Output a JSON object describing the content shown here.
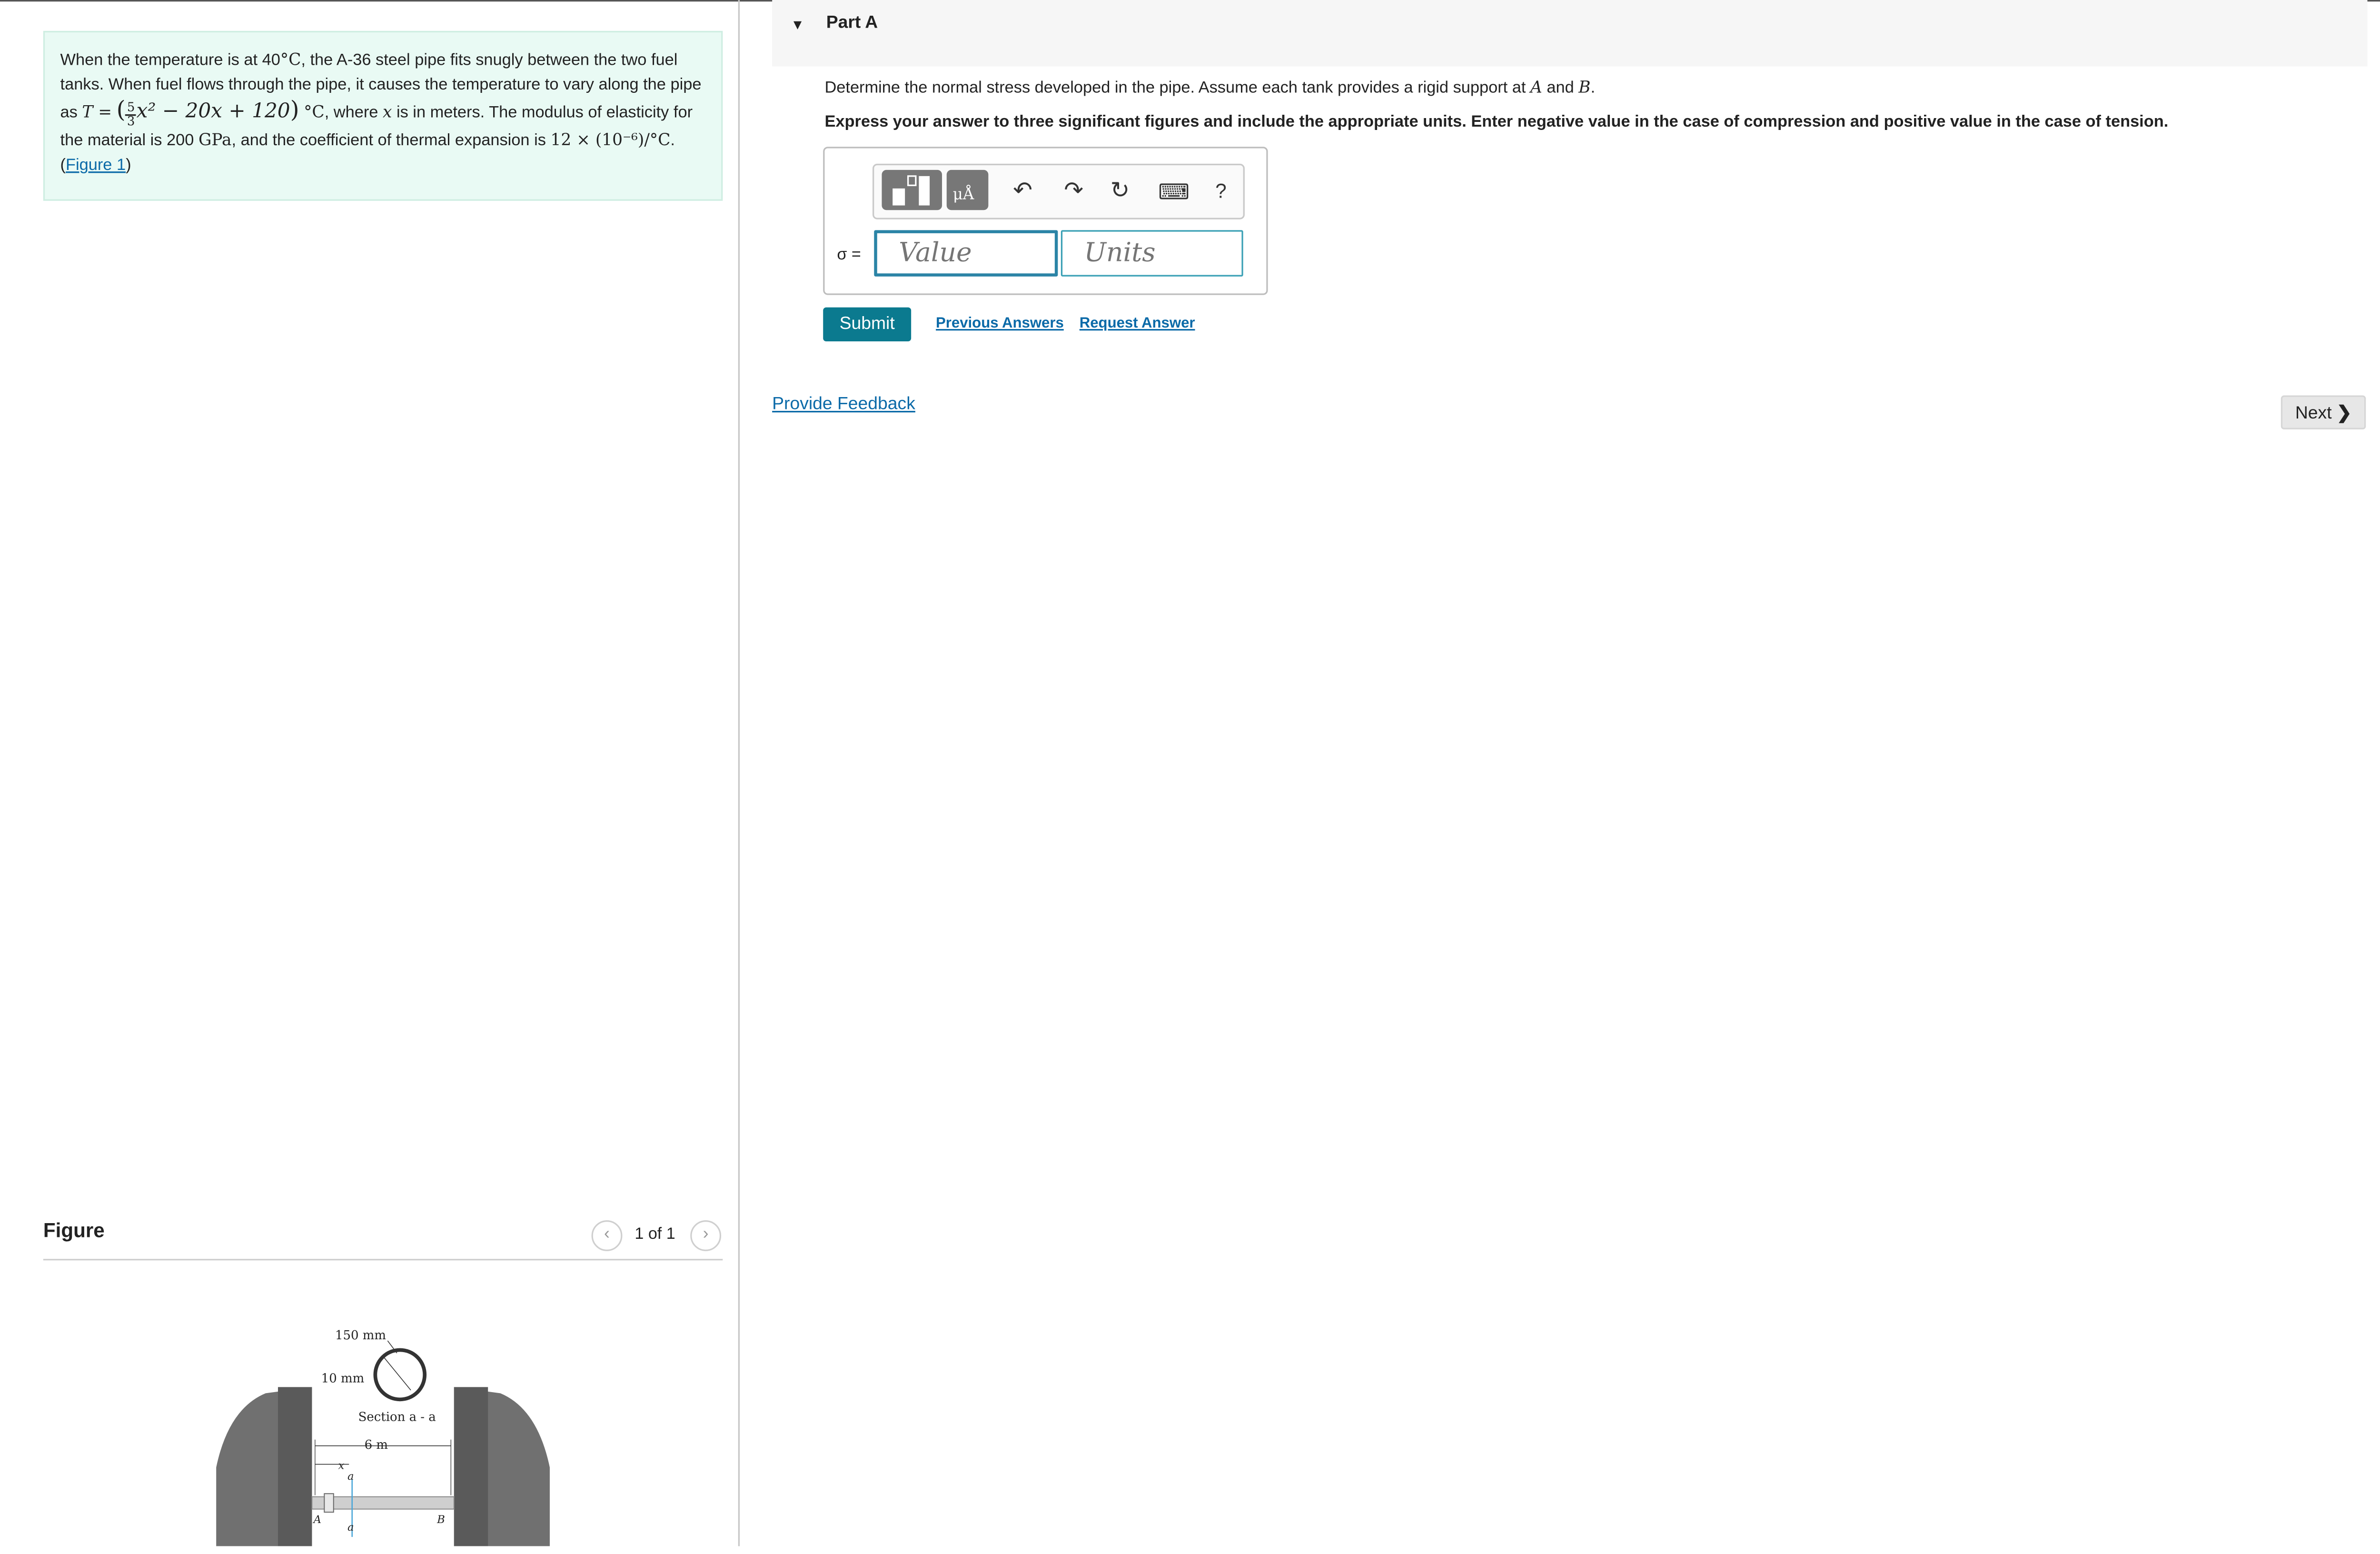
{
  "problem": {
    "seg1": "When the temperature is at 40",
    "deg_c": "°C",
    "seg2": ", the A-36 steel pipe fits snugly between the two fuel tanks. When fuel flows through the pipe, it causes the temperature to vary along the pipe as ",
    "t_eq": "T =",
    "frac_num": "5",
    "frac_den": "3",
    "poly": "x² − 20x + 120",
    "seg3": ", where ",
    "var_x": "x",
    "seg4": " is in meters. The modulus of elasticity for the material is 200 ",
    "gpa": "GPa",
    "seg5": ", and the coefficient of thermal expansion is ",
    "alpha": "12 × (10⁻⁶)/°C",
    "seg6": ". (",
    "figure_link": "Figure 1",
    "seg7": ")"
  },
  "figure": {
    "title": "Figure",
    "count": "1 of 1",
    "prev_icon": "chevron-left-icon",
    "next_icon": "chevron-right-icon",
    "labels": {
      "dia": "150 mm",
      "thick": "10 mm",
      "section": "Section a - a",
      "length": "6 m",
      "x": "x",
      "a_top": "a",
      "a_bottom": "a",
      "A": "A",
      "B": "B"
    }
  },
  "part": {
    "title": "Part A",
    "question_pre": "Determine the normal stress developed in the pipe. Assume each tank provides a rigid support at ",
    "A": "A",
    "and": " and ",
    "B": "B",
    "period": ".",
    "instruction": "Express your answer to three significant figures and include the appropriate units. Enter negative value in the case of compression and positive value in the case of tension."
  },
  "toolbar": {
    "templates_icon": "templates-icon",
    "units_label": "μÅ",
    "undo": "↶",
    "redo": "↷",
    "reset": "↻",
    "keyboard": "⌨",
    "help": "?"
  },
  "answer": {
    "label": "σ =",
    "value_placeholder": "Value",
    "units_placeholder": "Units"
  },
  "actions": {
    "submit": "Submit",
    "previous_answers": "Previous Answers",
    "request_answer": "Request Answer",
    "feedback": "Provide Feedback",
    "next": "Next"
  },
  "colors": {
    "accent": "#0b7a8f",
    "link": "#0b6aa8",
    "problem_bg": "#e9faf4"
  }
}
